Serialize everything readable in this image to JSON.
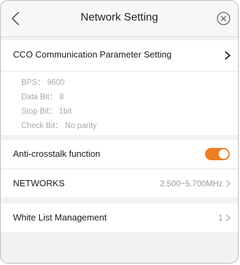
{
  "header": {
    "title": "Network Setting"
  },
  "cco": {
    "label": "CCO Communication Parameter Setting"
  },
  "params": [
    "BPS： 9600",
    "Data Bit： 8",
    "Stop Bit： 1bit",
    "Check Bit： No parity"
  ],
  "anticrosstalk": {
    "label": "Anti-crosstalk function",
    "enabled": true
  },
  "networks": {
    "label": "NETWORKS",
    "value": "2.500~5.700MHz"
  },
  "whitelist": {
    "label": "White List Management",
    "value": "1"
  },
  "colors": {
    "accent": "#ef7d22"
  },
  "icons": {
    "back": "chevron-left-icon",
    "close": "close-circle-icon",
    "disclosure": "chevron-right-icon"
  }
}
